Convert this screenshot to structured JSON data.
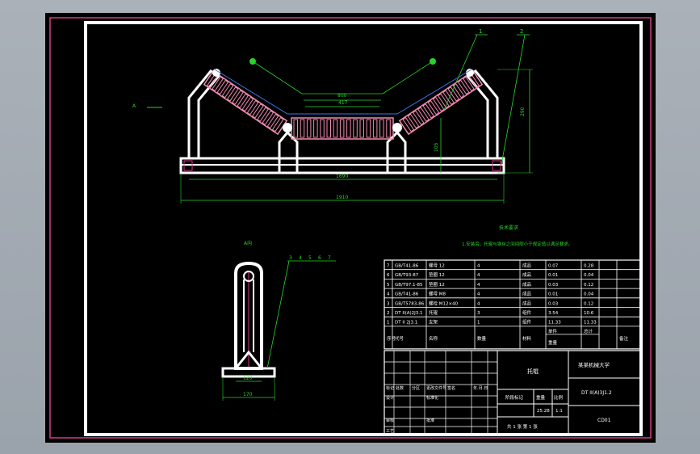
{
  "drawing": {
    "top_view": {
      "dims": {
        "d_800": "800",
        "d_417": "417",
        "d_1690": "1690",
        "d_1910": "1910",
        "d_290": "290",
        "d_105": "105",
        "d_leader_left": "A",
        "d_callout_1": "1",
        "d_callout_2": "2"
      }
    },
    "section_label": "A向",
    "side_view": {
      "d_120": "120",
      "d_170": "170",
      "callouts": [
        "3",
        "4",
        "5",
        "6",
        "7"
      ]
    }
  },
  "notes": {
    "title": "技术要求",
    "line1": "1.安装后，托辊与钢丝之间间隙小于规定值以满足要求。"
  },
  "bom": {
    "rows": [
      {
        "no": "7",
        "code": "GB/T41-86",
        "name": "螺母 12",
        "qty": "4",
        "material": "成品",
        "w1": "0.07",
        "w2": "0.28"
      },
      {
        "no": "6",
        "code": "GB/T93-87",
        "name": "垫圈 12",
        "qty": "4",
        "material": "成品",
        "w1": "0.01",
        "w2": "0.04"
      },
      {
        "no": "5",
        "code": "GB/T97.1-85",
        "name": "垫圈 12",
        "qty": "4",
        "material": "成品",
        "w1": "0.03",
        "w2": "0.12"
      },
      {
        "no": "4",
        "code": "GB/T41-86",
        "name": "螺母 M8",
        "qty": "4",
        "material": "成品",
        "w1": "0.01",
        "w2": "0.04"
      },
      {
        "no": "3",
        "code": "GB/T5783-86",
        "name": "螺栓 M12×40",
        "qty": "4",
        "material": "成品",
        "w1": "0.03",
        "w2": "0.12"
      },
      {
        "no": "2",
        "code": "DT II(A)2J3.1",
        "name": "托辊",
        "qty": "3",
        "material": "组件",
        "w1": "3.54",
        "w2": "10.6"
      },
      {
        "no": "1",
        "code": "DT II 2J3.1",
        "name": "支架",
        "qty": "1",
        "material": "组件",
        "w1": "11.33",
        "w2": "11.33"
      }
    ],
    "header": {
      "no": "序号",
      "code": "代号",
      "name": "名称",
      "qty": "数量",
      "material": "材料",
      "w1": "单件",
      "w2": "总计",
      "weight": "重量",
      "remark": "备注"
    }
  },
  "titleblock": {
    "part_name": "托辊",
    "school": "某某机械大学",
    "drawing_no": "DT II(A)3J1.2",
    "code": "CD01",
    "mark_label": "标记",
    "count_label": "处数",
    "zone_label": "分区",
    "change_label": "更改文件号",
    "sign_label": "签名",
    "date_label": "年.月.日",
    "design_label": "设计",
    "std_label": "标准化",
    "stage_label": "阶段标记",
    "weight_label": "重量",
    "scale_label": "比例",
    "check_label": "审核",
    "craft_label": "工艺",
    "approve_label": "批准",
    "weight_val": "25.28",
    "scale_val": "1:1",
    "sheets": "共 1 张  第 1 张"
  },
  "colors": {
    "frame": "#ffffff",
    "border_accent": "#d23c8a",
    "dim": "#27d427",
    "roller": "#f08ab0",
    "roller_blue": "#3a74e8",
    "background": "#000000"
  }
}
